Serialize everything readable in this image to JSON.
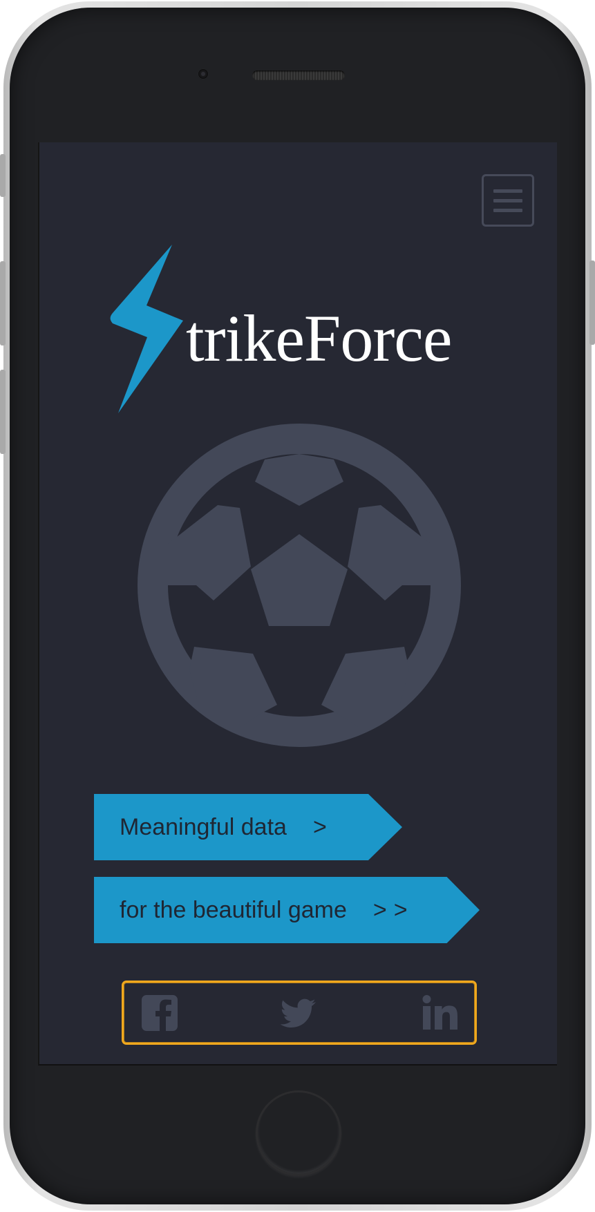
{
  "app": {
    "brand_text": "trikeForce",
    "brand_initial_shape": "lightning-bolt-S",
    "accent_color": "#1c97c9",
    "background_color": "#262833",
    "muted_color": "#434858"
  },
  "header": {
    "menu_icon": "hamburger-menu-icon"
  },
  "hero": {
    "image": "soccer-ball-icon"
  },
  "cta_buttons": [
    {
      "label": "Meaningful data",
      "arrow": ">"
    },
    {
      "label": "for the beautiful game",
      "arrow": ">>"
    }
  ],
  "social": {
    "focus_color": "#f0a81e",
    "links": [
      {
        "icon": "facebook-icon"
      },
      {
        "icon": "twitter-icon"
      },
      {
        "icon": "linkedin-icon"
      }
    ]
  }
}
